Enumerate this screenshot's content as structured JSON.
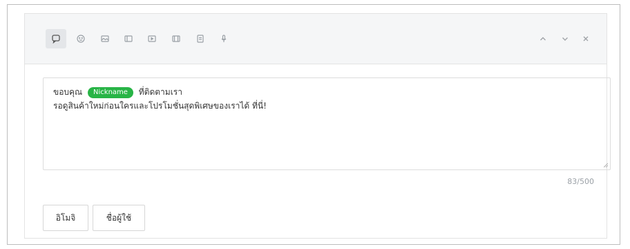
{
  "toolbar": {
    "tools": [
      {
        "icon": "speech-bubble-icon",
        "active": true
      },
      {
        "icon": "smiley-icon",
        "active": false
      },
      {
        "icon": "image-icon",
        "active": false
      },
      {
        "icon": "card-icon",
        "active": false
      },
      {
        "icon": "video-icon",
        "active": false
      },
      {
        "icon": "film-icon",
        "active": false
      },
      {
        "icon": "file-icon",
        "active": false
      },
      {
        "icon": "microphone-icon",
        "active": false
      }
    ],
    "nav": [
      "chevron-up-icon",
      "chevron-down-icon",
      "close-icon"
    ]
  },
  "message": {
    "line1_before": "ขอบคุณ",
    "tag": "Nickname",
    "line1_after": "ที่ติดตามเรา",
    "line2": "รอดูสินค้าใหม่ก่อนใครและโปรโมชั่นสุดพิเศษของเราได้ ที่นี่!"
  },
  "counter": "83/500",
  "buttons": {
    "emoji": "อิโมจิ",
    "name": "ชื่อผู้ใช้"
  },
  "colors": {
    "tag_green": "#28b446",
    "toolbar_bg": "#f5f6f7"
  }
}
